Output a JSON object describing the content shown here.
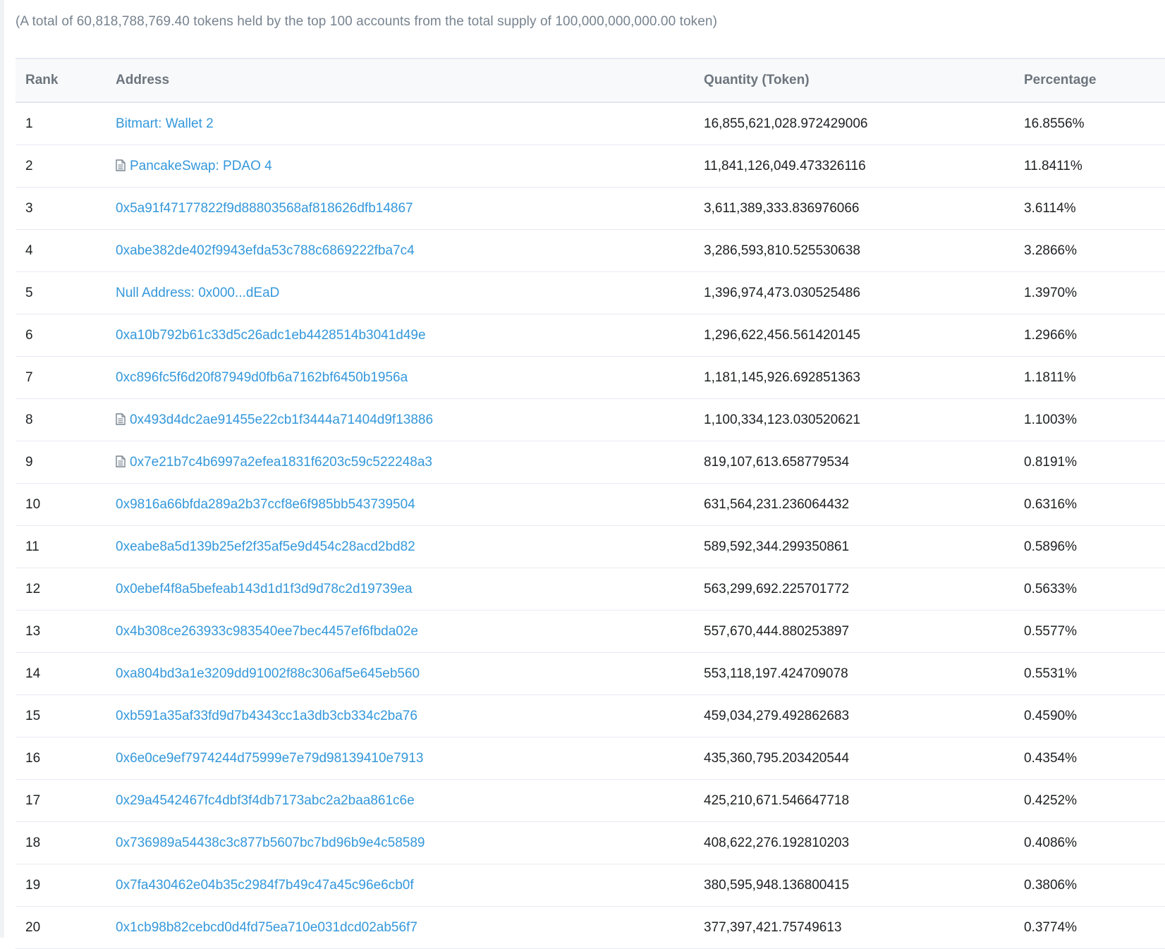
{
  "summary": "(A total of 60,818,788,769.40 tokens held by the top 100 accounts from the total supply of 100,000,000,000.00 token)",
  "table": {
    "headers": {
      "rank": "Rank",
      "address": "Address",
      "quantity": "Quantity (Token)",
      "percentage": "Percentage"
    },
    "rows": [
      {
        "rank": "1",
        "address": "Bitmart: Wallet 2",
        "contract": false,
        "quantity": "16,855,621,028.972429006",
        "percentage": "16.8556%"
      },
      {
        "rank": "2",
        "address": "PancakeSwap: PDAO 4",
        "contract": true,
        "quantity": "11,841,126,049.473326116",
        "percentage": "11.8411%"
      },
      {
        "rank": "3",
        "address": "0x5a91f47177822f9d88803568af818626dfb14867",
        "contract": false,
        "quantity": "3,611,389,333.836976066",
        "percentage": "3.6114%"
      },
      {
        "rank": "4",
        "address": "0xabe382de402f9943efda53c788c6869222fba7c4",
        "contract": false,
        "quantity": "3,286,593,810.525530638",
        "percentage": "3.2866%"
      },
      {
        "rank": "5",
        "address": "Null Address: 0x000...dEaD",
        "contract": false,
        "quantity": "1,396,974,473.030525486",
        "percentage": "1.3970%"
      },
      {
        "rank": "6",
        "address": "0xa10b792b61c33d5c26adc1eb4428514b3041d49e",
        "contract": false,
        "quantity": "1,296,622,456.561420145",
        "percentage": "1.2966%"
      },
      {
        "rank": "7",
        "address": "0xc896fc5f6d20f87949d0fb6a7162bf6450b1956a",
        "contract": false,
        "quantity": "1,181,145,926.692851363",
        "percentage": "1.1811%"
      },
      {
        "rank": "8",
        "address": "0x493d4dc2ae91455e22cb1f3444a71404d9f13886",
        "contract": true,
        "quantity": "1,100,334,123.030520621",
        "percentage": "1.1003%"
      },
      {
        "rank": "9",
        "address": "0x7e21b7c4b6997a2efea1831f6203c59c522248a3",
        "contract": true,
        "quantity": "819,107,613.658779534",
        "percentage": "0.8191%"
      },
      {
        "rank": "10",
        "address": "0x9816a66bfda289a2b37ccf8e6f985bb543739504",
        "contract": false,
        "quantity": "631,564,231.236064432",
        "percentage": "0.6316%"
      },
      {
        "rank": "11",
        "address": "0xeabe8a5d139b25ef2f35af5e9d454c28acd2bd82",
        "contract": false,
        "quantity": "589,592,344.299350861",
        "percentage": "0.5896%"
      },
      {
        "rank": "12",
        "address": "0x0ebef4f8a5befeab143d1d1f3d9d78c2d19739ea",
        "contract": false,
        "quantity": "563,299,692.225701772",
        "percentage": "0.5633%"
      },
      {
        "rank": "13",
        "address": "0x4b308ce263933c983540ee7bec4457ef6fbda02e",
        "contract": false,
        "quantity": "557,670,444.880253897",
        "percentage": "0.5577%"
      },
      {
        "rank": "14",
        "address": "0xa804bd3a1e3209dd91002f88c306af5e645eb560",
        "contract": false,
        "quantity": "553,118,197.424709078",
        "percentage": "0.5531%"
      },
      {
        "rank": "15",
        "address": "0xb591a35af33fd9d7b4343cc1a3db3cb334c2ba76",
        "contract": false,
        "quantity": "459,034,279.492862683",
        "percentage": "0.4590%"
      },
      {
        "rank": "16",
        "address": "0x6e0ce9ef7974244d75999e7e79d98139410e7913",
        "contract": false,
        "quantity": "435,360,795.203420544",
        "percentage": "0.4354%"
      },
      {
        "rank": "17",
        "address": "0x29a4542467fc4dbf3f4db7173abc2a2baa861c6e",
        "contract": false,
        "quantity": "425,210,671.546647718",
        "percentage": "0.4252%"
      },
      {
        "rank": "18",
        "address": "0x736989a54438c3c877b5607bc7bd96b9e4c58589",
        "contract": false,
        "quantity": "408,622,276.192810203",
        "percentage": "0.4086%"
      },
      {
        "rank": "19",
        "address": "0x7fa430462e04b35c2984f7b49c47a45c96e6cb0f",
        "contract": false,
        "quantity": "380,595,948.136800415",
        "percentage": "0.3806%"
      },
      {
        "rank": "20",
        "address": "0x1cb98b82cebcd0d4fd75ea710e031dcd02ab56f7",
        "contract": false,
        "quantity": "377,397,421.75749613",
        "percentage": "0.3774%"
      }
    ]
  },
  "icons": {
    "contract": "contract-file-icon"
  },
  "colors": {
    "link": "#3498db",
    "text": "#1e2022",
    "muted": "#77838f",
    "header_bg": "#f8f9fa",
    "border": "#e7eaf3"
  }
}
